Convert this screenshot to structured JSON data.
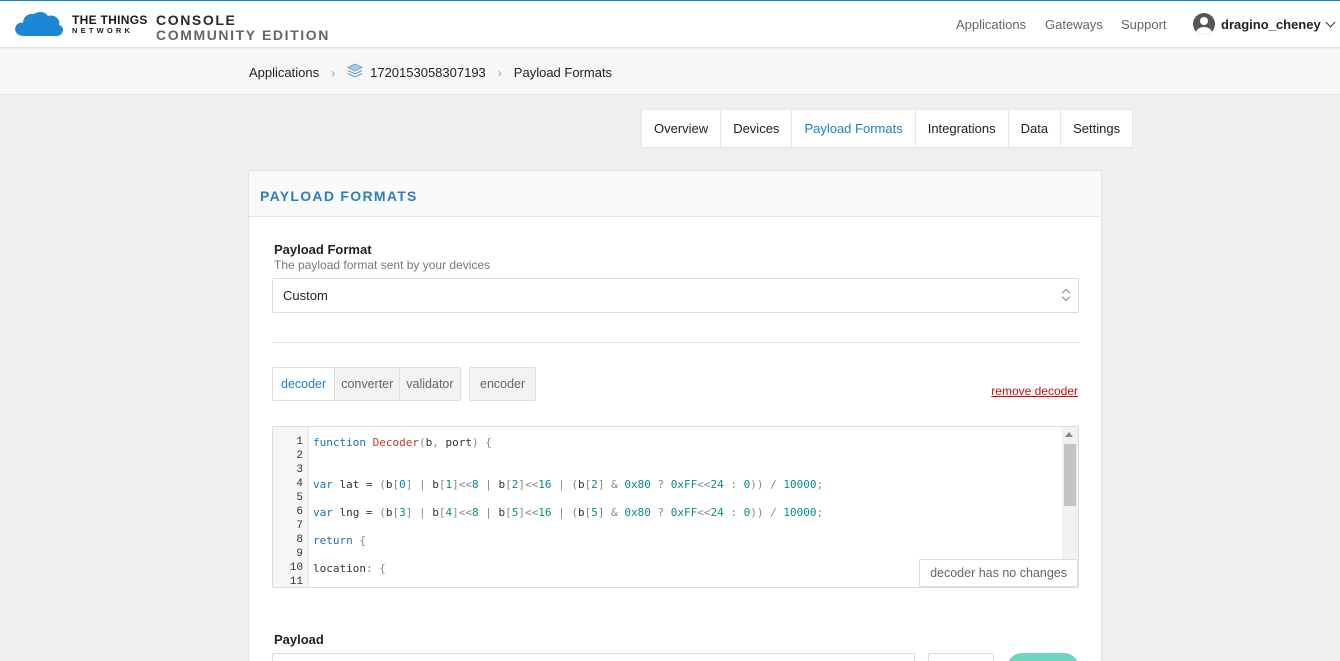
{
  "brand": {
    "network_line1": "THE THINGS",
    "network_line2": "NETWORK",
    "console_line1": "CONSOLE",
    "console_line2": "COMMUNITY EDITION",
    "accent_color": "#0d83d0"
  },
  "nav": {
    "applications": "Applications",
    "gateways": "Gateways",
    "support": "Support",
    "username": "dragino_cheney"
  },
  "breadcrumb": {
    "item1": "Applications",
    "item2": "1720153058307193",
    "item3": "Payload Formats"
  },
  "tabs": [
    {
      "label": "Overview"
    },
    {
      "label": "Devices"
    },
    {
      "label": "Payload Formats"
    },
    {
      "label": "Integrations"
    },
    {
      "label": "Data"
    },
    {
      "label": "Settings"
    }
  ],
  "card": {
    "title": "PAYLOAD FORMATS",
    "format_label": "Payload Format",
    "format_help": "The payload format sent by your devices",
    "format_value": "Custom",
    "function_tabs": [
      "decoder",
      "converter",
      "validator"
    ],
    "encoder_tab": "encoder",
    "remove_link": "remove decoder",
    "status": "decoder has no changes",
    "payload_label": "Payload"
  },
  "editor": {
    "line_numbers": [
      "1",
      "2",
      "3",
      "4",
      "5",
      "6",
      "7",
      "8",
      "9",
      "10",
      "11"
    ],
    "lines": [
      "function Decoder(b, port) {",
      "",
      "",
      "var lat = (b[0] | b[1]<<8 | b[2]<<16 | (b[2] & 0x80 ? 0xFF<<24 : 0)) / 10000;",
      "",
      "var lng = (b[3] | b[4]<<8 | b[5]<<16 | (b[5] & 0x80 ? 0xFF<<24 : 0)) / 10000;",
      "",
      "return {",
      "",
      "location: {",
      ""
    ]
  }
}
